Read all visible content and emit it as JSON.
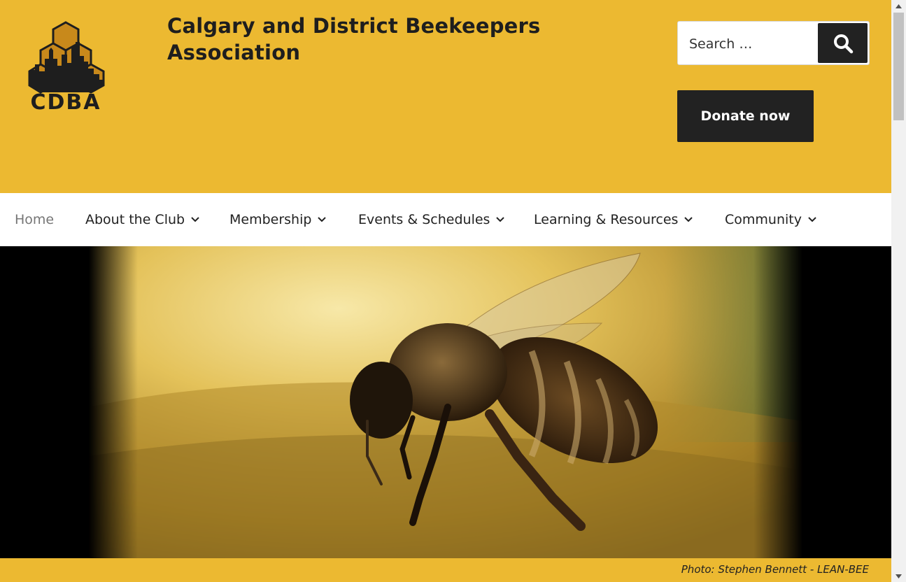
{
  "header": {
    "logo_text": "CDBA",
    "site_title": "Calgary and District Beekeepers Association",
    "search_placeholder": "Search …",
    "search_icon": "search-icon",
    "donate_label": "Donate now"
  },
  "nav": {
    "items": [
      {
        "label": "Home",
        "has_dropdown": false
      },
      {
        "label": "About the Club",
        "has_dropdown": true
      },
      {
        "label": "Membership",
        "has_dropdown": true
      },
      {
        "label": "Events & Schedules",
        "has_dropdown": true
      },
      {
        "label": "Learning & Resources",
        "has_dropdown": true
      },
      {
        "label": "Community",
        "has_dropdown": true
      }
    ]
  },
  "hero": {
    "caption": "Photo: Stephen Bennett - LEAN-BEE"
  },
  "colors": {
    "brand_yellow": "#ecb931",
    "dark": "#222222",
    "nav_active": "#767676"
  }
}
